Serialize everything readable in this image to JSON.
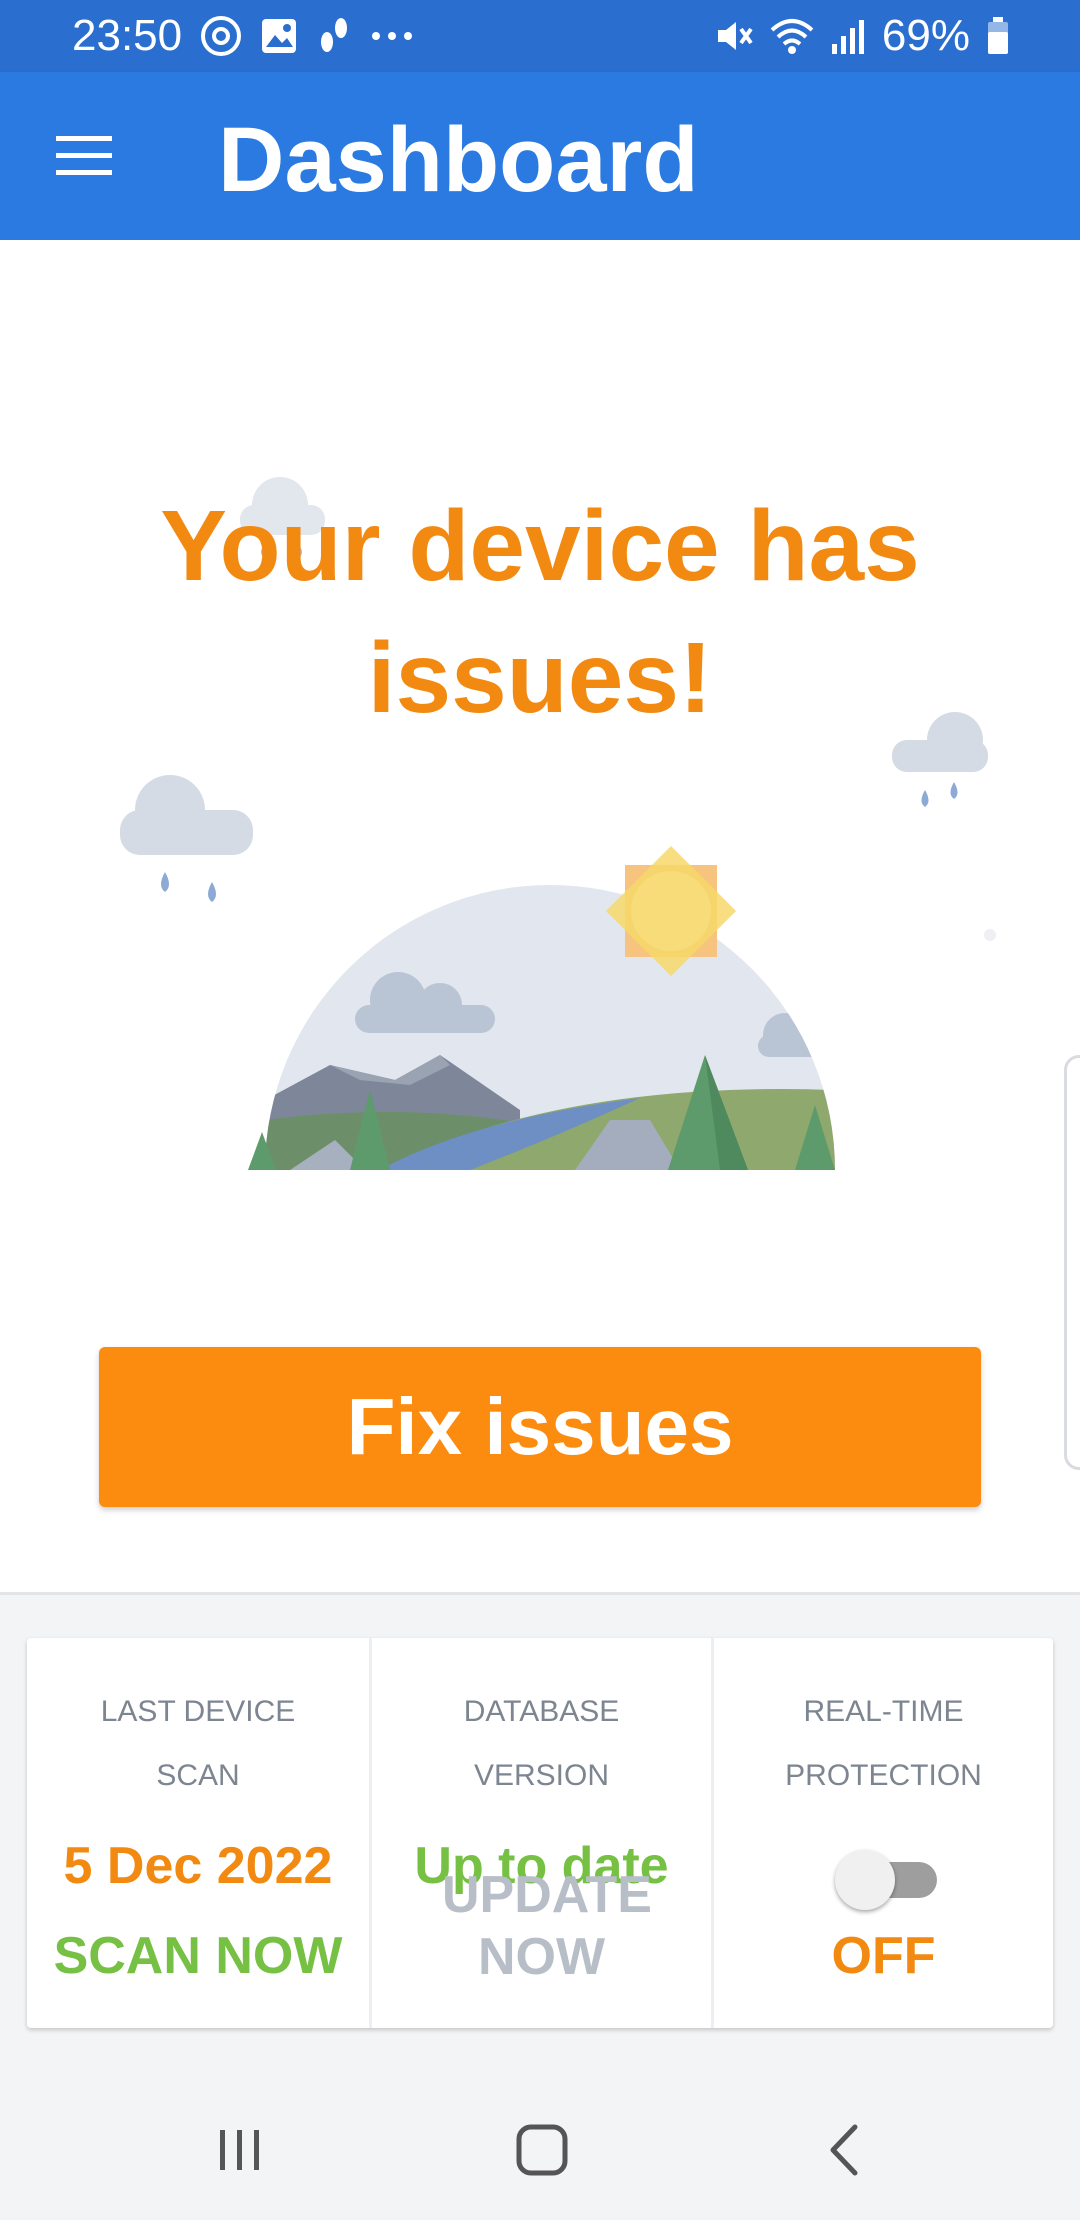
{
  "status_bar": {
    "time": "23:50",
    "left_icons": [
      "notification-app-icon",
      "gallery-icon",
      "steps-icon",
      "more-dots-icon"
    ],
    "right_icons": [
      "mute-icon",
      "wifi-icon",
      "signal-icon",
      "battery-icon"
    ],
    "battery": "69%"
  },
  "app_bar": {
    "title": "Dashboard",
    "menu_icon": "hamburger-menu-icon",
    "background": "#2a7ae2"
  },
  "hero": {
    "headline": "Your device has issues!",
    "illustration": "weather-landscape-illustration",
    "accent": "#f28a12"
  },
  "fix_button": {
    "label": "Fix issues",
    "color": "#fb8c10"
  },
  "cards": {
    "last_scan": {
      "label": "LAST DEVICE SCAN",
      "value": "5 Dec 2022",
      "action": "SCAN NOW"
    },
    "database": {
      "label": "DATABASE VERSION",
      "value": "Up to date",
      "action": "UPDATE NOW"
    },
    "protection": {
      "label": "REAL-TIME PROTECTION",
      "toggle_state": "off",
      "status": "OFF"
    }
  },
  "nav_bar": {
    "icons": [
      "recent-apps-icon",
      "home-icon",
      "back-icon"
    ]
  }
}
